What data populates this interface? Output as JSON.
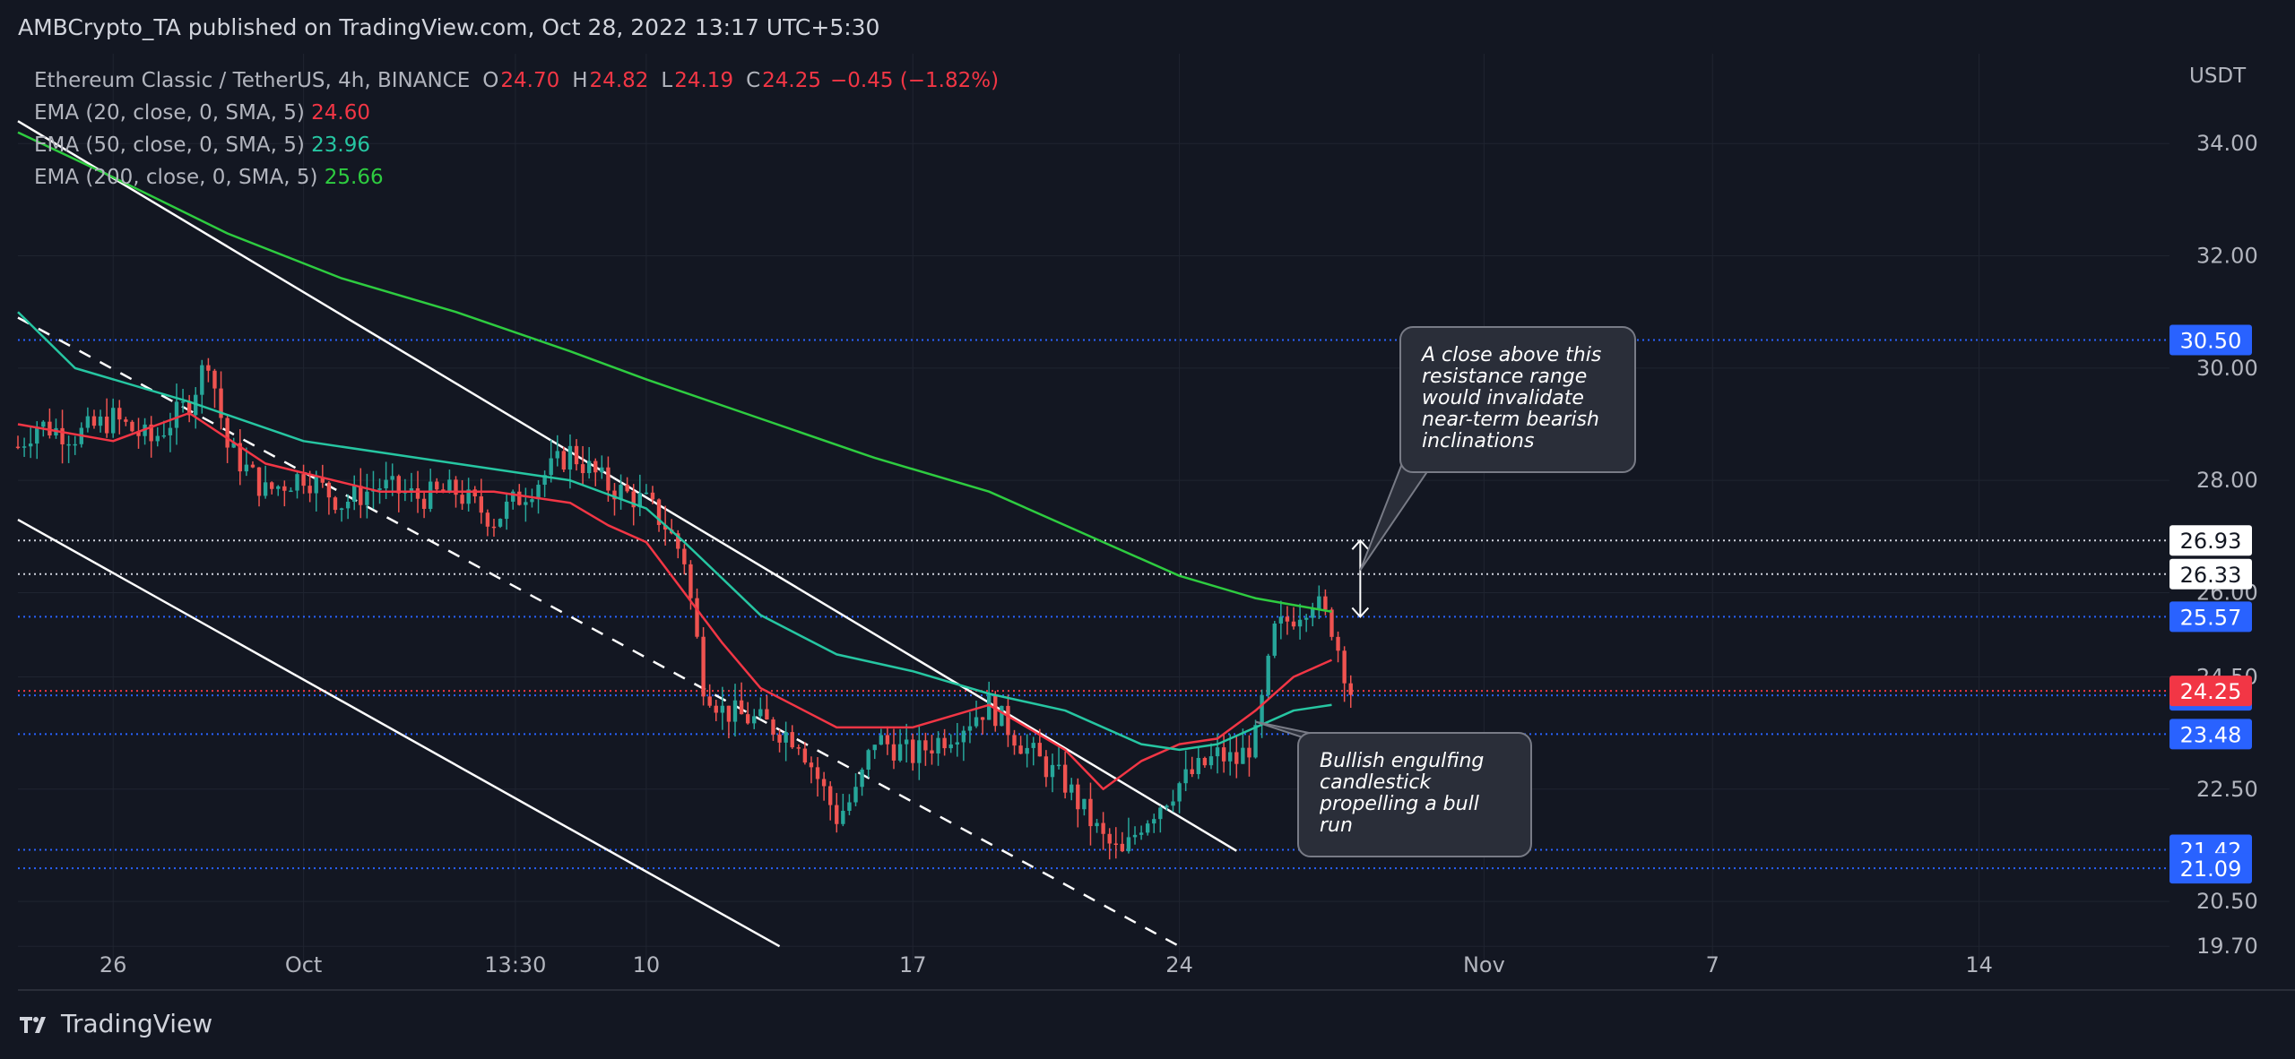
{
  "header": {
    "publisher_line": "AMBCrypto_TA published on TradingView.com, Oct 28, 2022 13:17 UTC+5:30"
  },
  "legend": {
    "symbol": "Ethereum Classic / TetherUS, 4h, BINANCE",
    "ohlc": {
      "o_label": "O",
      "o": "24.70",
      "h_label": "H",
      "h": "24.82",
      "l_label": "L",
      "l": "24.19",
      "c_label": "C",
      "c": "24.25",
      "change": "−0.45 (−1.82%)"
    },
    "indicators": [
      {
        "label": "EMA (20, close, 0, SMA, 5)",
        "value": "24.60",
        "color": "#f23645"
      },
      {
        "label": "EMA (50, close, 0, SMA, 5)",
        "value": "23.96",
        "color": "#26c6a2"
      },
      {
        "label": "EMA (200, close, 0, SMA, 5)",
        "value": "25.66",
        "color": "#2ecc40"
      }
    ]
  },
  "footer": {
    "brand": "TradingView"
  },
  "colors": {
    "background": "#131722",
    "grid": "#1f2430",
    "axis_text": "#b2b5be",
    "up": "#26a69a",
    "down": "#ef5350",
    "ema20": "#f23645",
    "ema50": "#26c6a2",
    "ema200": "#2ecc40",
    "level_blue": "#2962ff",
    "level_white": "#ffffff",
    "last_price": "#f23645",
    "channel": "#ffffff",
    "callout_bg": "#2a2e39",
    "callout_border": "#787b86"
  },
  "chart_data": {
    "type": "candlestick",
    "symbol": "Ethereum Classic / TetherUS",
    "interval": "4h",
    "exchange": "BINANCE",
    "currency": "USDT",
    "y_ticks": [
      "34.00",
      "32.00",
      "30.00",
      "28.00",
      "26.00",
      "24.50",
      "22.50",
      "20.50",
      "19.70"
    ],
    "x_ticks": [
      {
        "label": "26",
        "date": "2022-09-26"
      },
      {
        "label": "Oct",
        "date": "2022-10-01"
      },
      {
        "label": "13:30",
        "date": "2022-10-06 13:30"
      },
      {
        "label": "10",
        "date": "2022-10-10"
      },
      {
        "label": "17",
        "date": "2022-10-17"
      },
      {
        "label": "24",
        "date": "2022-10-24"
      },
      {
        "label": "Nov",
        "date": "2022-11-01"
      },
      {
        "label": "7",
        "date": "2022-11-07"
      },
      {
        "label": "14",
        "date": "2022-11-14"
      }
    ],
    "ylim": [
      19.4,
      35.6
    ],
    "xlim": [
      "2022-09-23 12:00",
      "2022-11-19 00:00"
    ],
    "last_price": {
      "value": "24.25",
      "color": "#f23645"
    },
    "price_levels": [
      {
        "value": "30.50",
        "color": "#2962ff"
      },
      {
        "value": "26.93",
        "color": "#ffffff"
      },
      {
        "value": "26.33",
        "color": "#ffffff"
      },
      {
        "value": "25.57",
        "color": "#2962ff"
      },
      {
        "value": "24.17",
        "color": "#2962ff"
      },
      {
        "value": "23.48",
        "color": "#2962ff"
      },
      {
        "value": "21.42",
        "color": "#2962ff"
      },
      {
        "value": "21.09",
        "color": "#2962ff"
      }
    ],
    "ema_series": [
      {
        "name": "EMA 20",
        "color": "#f23645",
        "points": [
          [
            "2022-09-23 12:00",
            29.0
          ],
          [
            "2022-09-26",
            28.7
          ],
          [
            "2022-09-28",
            29.2
          ],
          [
            "2022-09-30",
            28.3
          ],
          [
            "2022-10-03",
            27.8
          ],
          [
            "2022-10-06",
            27.8
          ],
          [
            "2022-10-08",
            27.6
          ],
          [
            "2022-10-09",
            27.2
          ],
          [
            "2022-10-10",
            26.9
          ],
          [
            "2022-10-11",
            26.0
          ],
          [
            "2022-10-12",
            25.1
          ],
          [
            "2022-10-13",
            24.3
          ],
          [
            "2022-10-15",
            23.6
          ],
          [
            "2022-10-17",
            23.6
          ],
          [
            "2022-10-19",
            24.0
          ],
          [
            "2022-10-21",
            23.2
          ],
          [
            "2022-10-22",
            22.5
          ],
          [
            "2022-10-23",
            23.0
          ],
          [
            "2022-10-24",
            23.3
          ],
          [
            "2022-10-25",
            23.4
          ],
          [
            "2022-10-26",
            23.9
          ],
          [
            "2022-10-27",
            24.5
          ],
          [
            "2022-10-28",
            24.8
          ]
        ]
      },
      {
        "name": "EMA 50",
        "color": "#26c6a2",
        "points": [
          [
            "2022-09-23 12:00",
            31.0
          ],
          [
            "2022-09-25",
            30.0
          ],
          [
            "2022-09-28",
            29.4
          ],
          [
            "2022-10-01",
            28.7
          ],
          [
            "2022-10-05",
            28.3
          ],
          [
            "2022-10-08",
            28.0
          ],
          [
            "2022-10-10",
            27.5
          ],
          [
            "2022-10-11",
            26.9
          ],
          [
            "2022-10-13",
            25.6
          ],
          [
            "2022-10-15",
            24.9
          ],
          [
            "2022-10-17",
            24.6
          ],
          [
            "2022-10-19",
            24.2
          ],
          [
            "2022-10-21",
            23.9
          ],
          [
            "2022-10-23",
            23.3
          ],
          [
            "2022-10-24",
            23.2
          ],
          [
            "2022-10-25",
            23.3
          ],
          [
            "2022-10-26",
            23.6
          ],
          [
            "2022-10-27",
            23.9
          ],
          [
            "2022-10-28",
            24.0
          ]
        ]
      },
      {
        "name": "EMA 200",
        "color": "#2ecc40",
        "points": [
          [
            "2022-09-23 12:00",
            34.2
          ],
          [
            "2022-09-26",
            33.4
          ],
          [
            "2022-09-29",
            32.4
          ],
          [
            "2022-10-02",
            31.6
          ],
          [
            "2022-10-05",
            31.0
          ],
          [
            "2022-10-08",
            30.3
          ],
          [
            "2022-10-10",
            29.8
          ],
          [
            "2022-10-13",
            29.1
          ],
          [
            "2022-10-16",
            28.4
          ],
          [
            "2022-10-19",
            27.8
          ],
          [
            "2022-10-22",
            26.9
          ],
          [
            "2022-10-24",
            26.3
          ],
          [
            "2022-10-26",
            25.9
          ],
          [
            "2022-10-28",
            25.66
          ]
        ]
      }
    ],
    "channel_lines": [
      {
        "style": "solid",
        "points": [
          [
            "2022-09-23 12:00",
            34.4
          ],
          [
            "2022-10-25 12:00",
            21.4
          ]
        ]
      },
      {
        "style": "dashed",
        "points": [
          [
            "2022-09-23 12:00",
            30.9
          ],
          [
            "2022-10-24",
            19.7
          ]
        ]
      },
      {
        "style": "solid",
        "points": [
          [
            "2022-09-23 12:00",
            27.3
          ],
          [
            "2022-10-13 12:00",
            19.7
          ]
        ]
      }
    ],
    "range_arrow": {
      "date": "2022-10-28 18:00",
      "from": "25.57",
      "to": "26.93"
    },
    "annotations": [
      {
        "text": "A close above this resistance range would invalidate near-term bearish inclinations",
        "points_to": [
          "2022-10-28 18:00",
          26.4
        ]
      },
      {
        "text": "Bullish engulfing candlestick propelling a bull run",
        "points_to": [
          "2022-10-26",
          23.7
        ]
      }
    ],
    "ohlc_path": [
      [
        "2022-09-23 12:00",
        28.6
      ],
      [
        "2022-09-24",
        29.0
      ],
      [
        "2022-09-25",
        28.8
      ],
      [
        "2022-09-26",
        29.1
      ],
      [
        "2022-09-27",
        28.7
      ],
      [
        "2022-09-28",
        29.4
      ],
      [
        "2022-09-28 12:00",
        30.2
      ],
      [
        "2022-09-29",
        28.6
      ],
      [
        "2022-09-30",
        27.8
      ],
      [
        "2022-10-01",
        28.1
      ],
      [
        "2022-10-02",
        27.6
      ],
      [
        "2022-10-03",
        27.9
      ],
      [
        "2022-10-04",
        27.7
      ],
      [
        "2022-10-05",
        27.8
      ],
      [
        "2022-10-06",
        27.3
      ],
      [
        "2022-10-06 12:00",
        27.6
      ],
      [
        "2022-10-07",
        27.9
      ],
      [
        "2022-10-08",
        28.5
      ],
      [
        "2022-10-08 12:00",
        28.2
      ],
      [
        "2022-10-09",
        27.9
      ],
      [
        "2022-10-10",
        27.6
      ],
      [
        "2022-10-10 12:00",
        27.2
      ],
      [
        "2022-10-11",
        26.6
      ],
      [
        "2022-10-11 12:00",
        24.4
      ],
      [
        "2022-10-12",
        23.9
      ],
      [
        "2022-10-13",
        23.7
      ],
      [
        "2022-10-14",
        23.4
      ],
      [
        "2022-10-15",
        22.0
      ],
      [
        "2022-10-15 12:00",
        22.4
      ],
      [
        "2022-10-16",
        23.4
      ],
      [
        "2022-10-17",
        23.1
      ],
      [
        "2022-10-18",
        23.5
      ],
      [
        "2022-10-19",
        24.0
      ],
      [
        "2022-10-20",
        23.2
      ],
      [
        "2022-10-21",
        22.6
      ],
      [
        "2022-10-22",
        21.6
      ],
      [
        "2022-10-22 12:00",
        21.3
      ],
      [
        "2022-10-23",
        21.9
      ],
      [
        "2022-10-24",
        22.6
      ],
      [
        "2022-10-25",
        23.1
      ],
      [
        "2022-10-25 12:00",
        23.0
      ],
      [
        "2022-10-26",
        23.4
      ],
      [
        "2022-10-26 12:00",
        25.3
      ],
      [
        "2022-10-27",
        25.6
      ],
      [
        "2022-10-27 12:00",
        25.9
      ],
      [
        "2022-10-28",
        25.4
      ],
      [
        "2022-10-28 12:00",
        24.25
      ]
    ]
  }
}
